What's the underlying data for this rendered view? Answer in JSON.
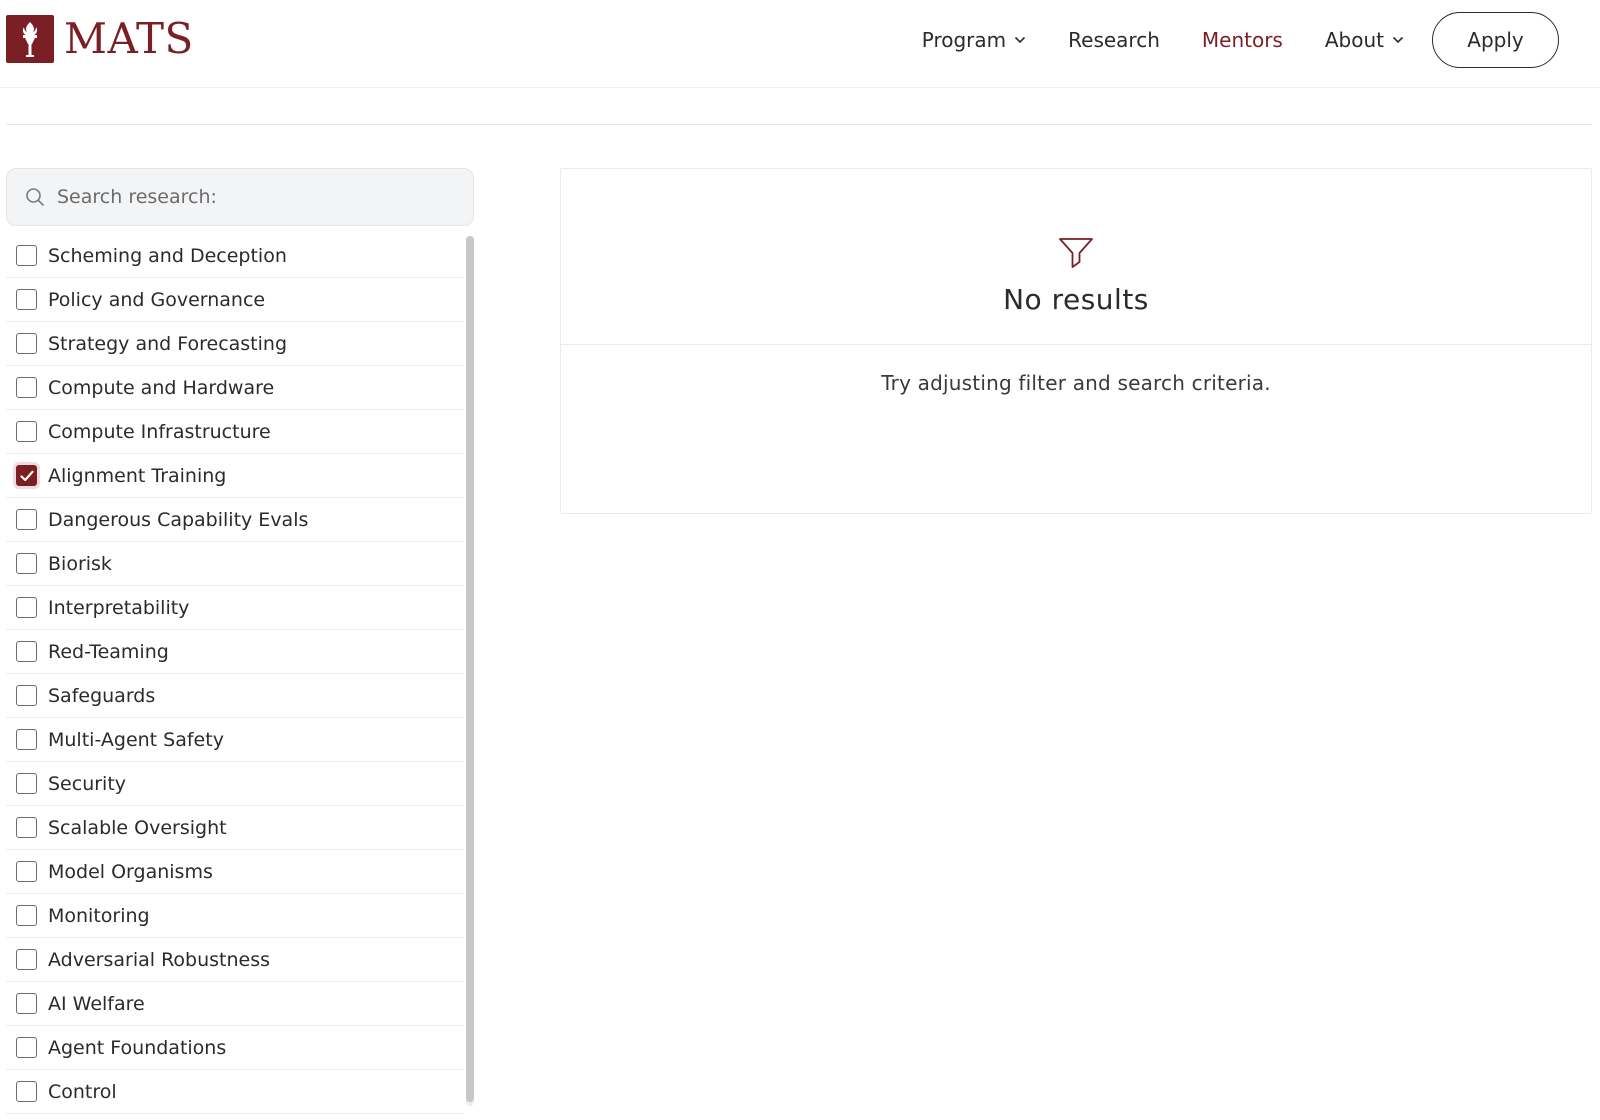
{
  "brand": {
    "name": "MATS",
    "color": "#7a1f23",
    "logo_icon": "torch-icon"
  },
  "nav": {
    "items": [
      {
        "label": "Program",
        "dropdown": true,
        "active": false
      },
      {
        "label": "Research",
        "dropdown": false,
        "active": false
      },
      {
        "label": "Mentors",
        "dropdown": false,
        "active": true
      },
      {
        "label": "About",
        "dropdown": true,
        "active": false
      }
    ],
    "apply_label": "Apply"
  },
  "search": {
    "placeholder": "Search research:",
    "value": ""
  },
  "filters": [
    {
      "label": "Scheming and Deception",
      "checked": false
    },
    {
      "label": "Policy and Governance",
      "checked": false
    },
    {
      "label": "Strategy and Forecasting",
      "checked": false
    },
    {
      "label": "Compute and Hardware",
      "checked": false
    },
    {
      "label": "Compute Infrastructure",
      "checked": false
    },
    {
      "label": "Alignment Training",
      "checked": true
    },
    {
      "label": "Dangerous Capability Evals",
      "checked": false
    },
    {
      "label": "Biorisk",
      "checked": false
    },
    {
      "label": "Interpretability",
      "checked": false
    },
    {
      "label": "Red-Teaming",
      "checked": false
    },
    {
      "label": "Safeguards",
      "checked": false
    },
    {
      "label": "Multi-Agent Safety",
      "checked": false
    },
    {
      "label": "Security",
      "checked": false
    },
    {
      "label": "Scalable Oversight",
      "checked": false
    },
    {
      "label": "Model Organisms",
      "checked": false
    },
    {
      "label": "Monitoring",
      "checked": false
    },
    {
      "label": "Adversarial Robustness",
      "checked": false
    },
    {
      "label": "AI Welfare",
      "checked": false
    },
    {
      "label": "Agent Foundations",
      "checked": false
    },
    {
      "label": "Control",
      "checked": false
    }
  ],
  "results": {
    "icon": "filter-funnel-icon",
    "title": "No results",
    "hint": "Try adjusting filter and search criteria."
  }
}
